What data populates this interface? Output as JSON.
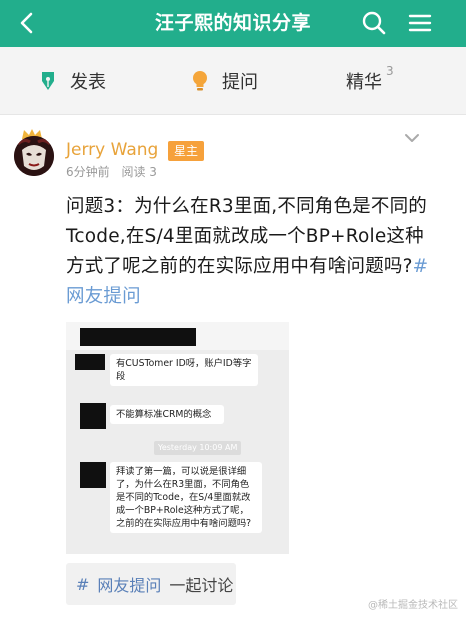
{
  "header": {
    "title": "汪子熙的知识分享"
  },
  "tabs": [
    {
      "label": "发表"
    },
    {
      "label": "提问"
    },
    {
      "label": "精华",
      "count": "3"
    }
  ],
  "post": {
    "author": "Jerry Wang",
    "badge": "星主",
    "time": "6分钟前",
    "reads": "阅读 3",
    "text": "问题3：为什么在R3里面,不同角色是不同的Tcode,在S/4里面就改成一个BP+Role这种方式了呢之前的在实际应用中有啥问题吗?",
    "tag": "#网友提问"
  },
  "chat_image": {
    "messages": [
      "有CUSTomer ID呀，账户ID等字段",
      "不能算标准CRM的概念",
      "拜读了第一篇，可以说是很详细了，为什么在R3里面，不同角色是不同的Tcode，在S/4里面就改成一个BP+Role这种方式了呢，之前的在实际应用中有啥问题吗?"
    ],
    "timestamp": "Yesterday 10:09 AM"
  },
  "chip": {
    "hash": "#",
    "tag": "网友提问",
    "action": "一起讨论"
  },
  "watermark": "@稀土掘金技术社区",
  "colors": {
    "brand": "#22ae8c",
    "author": "#e8a33a",
    "badge": "#f6a13b",
    "tag_link": "#6a9bd3"
  }
}
